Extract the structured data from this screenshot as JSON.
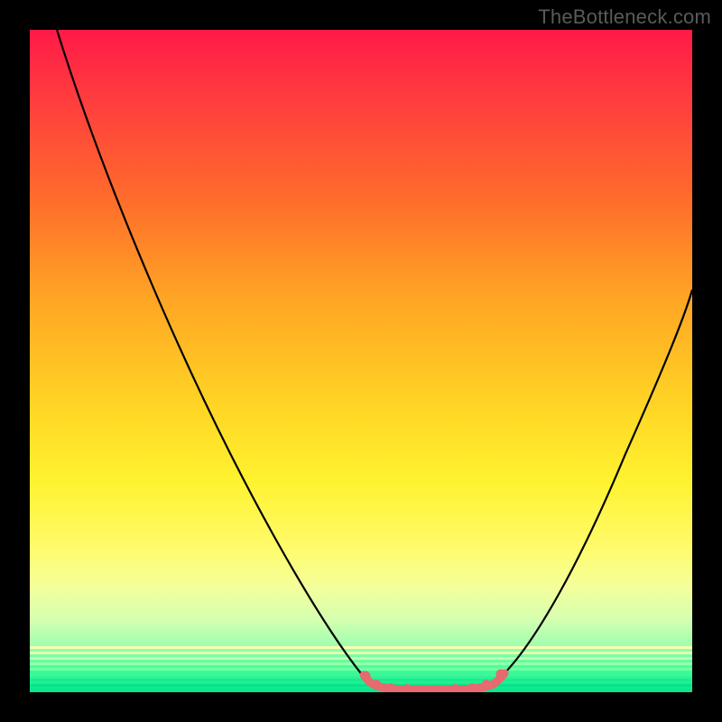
{
  "watermark": "TheBottleneck.com",
  "chart_data": {
    "type": "line",
    "title": "",
    "xlabel": "",
    "ylabel": "",
    "xlim": [
      0,
      100
    ],
    "ylim": [
      0,
      100
    ],
    "grid": false,
    "legend": false,
    "series": [
      {
        "name": "left-curve",
        "x": [
          4,
          10,
          18,
          26,
          34,
          42,
          48,
          51
        ],
        "values": [
          100,
          84,
          66,
          48,
          31,
          15,
          4,
          1
        ]
      },
      {
        "name": "right-curve",
        "x": [
          71,
          75,
          80,
          86,
          92,
          98,
          100
        ],
        "values": [
          2,
          6,
          14,
          26,
          40,
          54,
          61
        ]
      },
      {
        "name": "floor-bumps",
        "x": [
          51,
          54,
          57,
          60,
          63,
          66,
          69,
          71
        ],
        "values": [
          1,
          0.5,
          0.5,
          0.5,
          0.5,
          0.5,
          1,
          2
        ]
      }
    ],
    "annotations": [],
    "background_gradient": {
      "orientation": "vertical",
      "stops": [
        {
          "pos": 0.0,
          "color": "#ff1a47"
        },
        {
          "pos": 0.25,
          "color": "#ff6a2c"
        },
        {
          "pos": 0.55,
          "color": "#ffd024"
        },
        {
          "pos": 0.78,
          "color": "#fffb6a"
        },
        {
          "pos": 0.93,
          "color": "#9fffb0"
        },
        {
          "pos": 1.0,
          "color": "#06e58b"
        }
      ]
    },
    "highlight_color": "#e66a6f",
    "curve_color": "#000000"
  }
}
